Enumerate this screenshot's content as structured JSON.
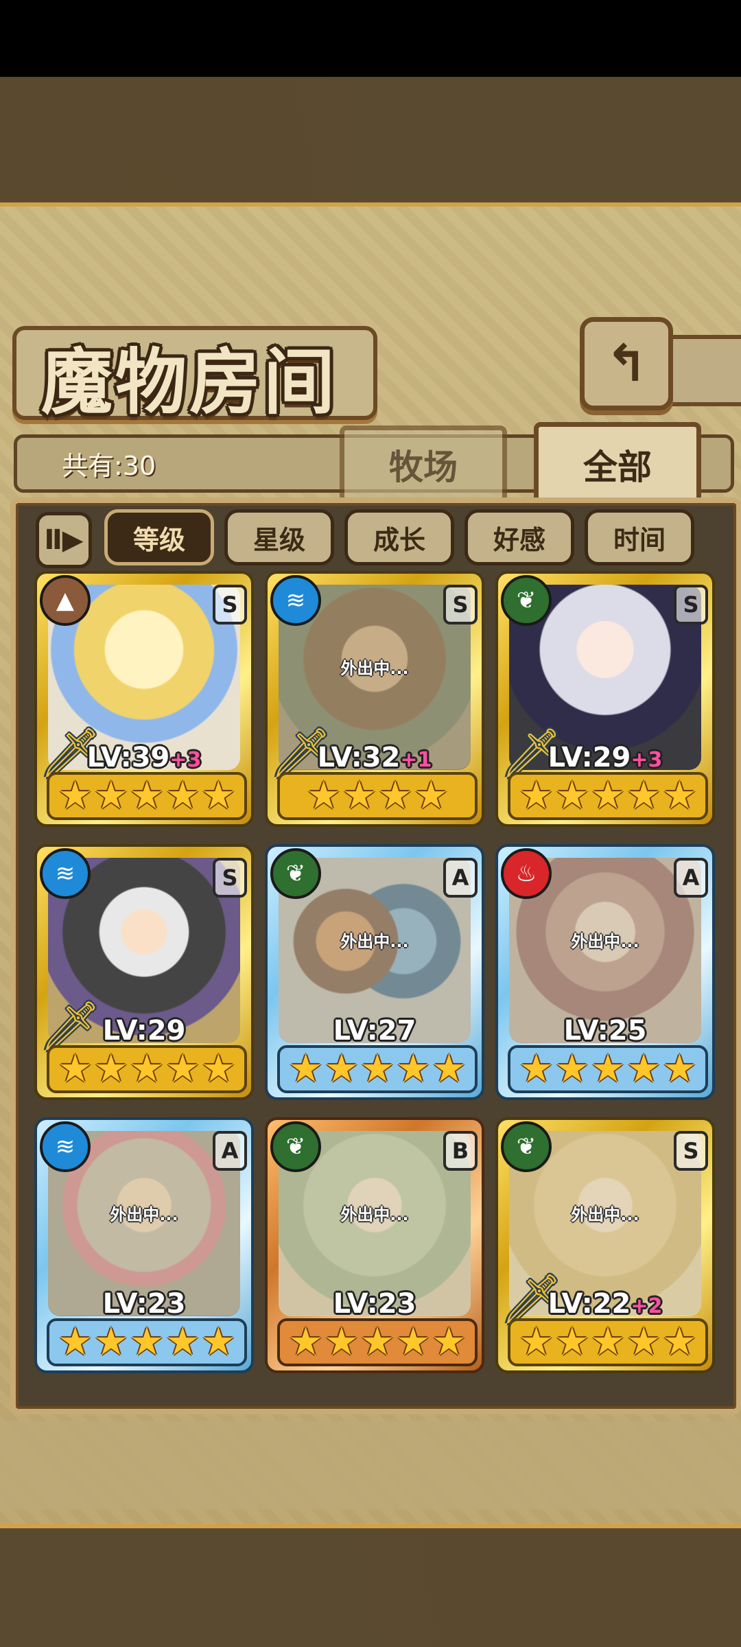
{
  "title": "魔物房间",
  "back_icon": "↰",
  "count_label": "共有:30",
  "tabs": {
    "ranch": "牧场",
    "all": "全部"
  },
  "sort_toggle": "Ⅱ▶",
  "filters": [
    "等级",
    "星级",
    "成长",
    "好感",
    "时间"
  ],
  "active_filter": "等级",
  "away_text": "外出中...",
  "monsters": [
    {
      "element": "earth",
      "rank": "S",
      "level": "LV:39",
      "bonus": "+3",
      "stars": 5,
      "frame": "gold",
      "away": false,
      "sword": true,
      "portrait": "p-blonde"
    },
    {
      "element": "water",
      "rank": "S",
      "level": "LV:32",
      "bonus": "+1",
      "stars": 4,
      "frame": "gold",
      "away": true,
      "sword": true,
      "portrait": "p-brown"
    },
    {
      "element": "wood",
      "rank": "S",
      "level": "LV:29",
      "bonus": "+3",
      "stars": 5,
      "frame": "gold",
      "away": false,
      "sword": true,
      "portrait": "p-silver"
    },
    {
      "element": "water",
      "rank": "S",
      "level": "LV:29",
      "bonus": "",
      "stars": 5,
      "frame": "gold",
      "away": false,
      "sword": true,
      "portrait": "p-hood"
    },
    {
      "element": "wood",
      "rank": "A",
      "level": "LV:27",
      "bonus": "",
      "stars": 5,
      "frame": "blue",
      "away": true,
      "sword": false,
      "portrait": "p-pair"
    },
    {
      "element": "fire",
      "rank": "A",
      "level": "LV:25",
      "bonus": "",
      "stars": 5,
      "frame": "blue",
      "away": true,
      "sword": false,
      "portrait": "p-dragon"
    },
    {
      "element": "water",
      "rank": "A",
      "level": "LV:23",
      "bonus": "",
      "stars": 5,
      "frame": "blue",
      "away": true,
      "sword": false,
      "portrait": "p-owl"
    },
    {
      "element": "wood",
      "rank": "B",
      "level": "LV:23",
      "bonus": "",
      "stars": 5,
      "frame": "bronze",
      "away": true,
      "sword": false,
      "portrait": "p-green"
    },
    {
      "element": "wood",
      "rank": "S",
      "level": "LV:22",
      "bonus": "+2",
      "stars": 5,
      "frame": "gold",
      "away": true,
      "sword": true,
      "portrait": "p-fair"
    }
  ],
  "element_glyphs": {
    "earth": "▲",
    "water": "≋",
    "wood": "❦",
    "fire": "♨"
  },
  "star_glyph": "★",
  "sword_glyph": "🗡"
}
